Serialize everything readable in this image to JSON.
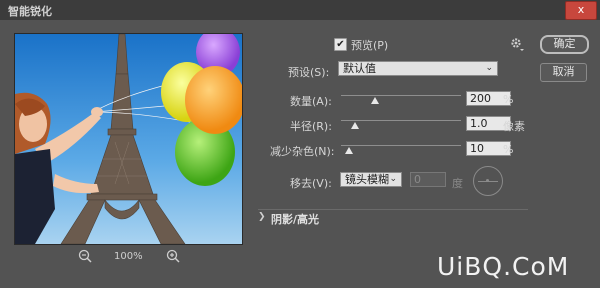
{
  "window": {
    "title": "智能锐化",
    "close_label": "x"
  },
  "preview_panel": {
    "zoom_level": "100%"
  },
  "controls": {
    "preview_label": "预览(P)",
    "preview_checked": true,
    "preset_label": "预设(S):",
    "preset_value": "默认值",
    "amount_label": "数量(A):",
    "amount_value": "200",
    "amount_unit": "%",
    "amount_slider": 0.28,
    "radius_label": "半径(R):",
    "radius_value": "1.0",
    "radius_unit": "像素",
    "radius_slider": 0.12,
    "noise_label": "减少杂色(N):",
    "noise_value": "10",
    "noise_unit": "%",
    "noise_slider": 0.07,
    "remove_label": "移去(V):",
    "remove_value": "镜头模糊",
    "angle_value": "0",
    "angle_unit": "度",
    "section_label": "阴影/高光"
  },
  "buttons": {
    "ok": "确定",
    "cancel": "取消"
  },
  "watermark": "UiBQ.CoM",
  "icons": {
    "zoom_out": "zoom-out-icon",
    "zoom_in": "zoom-in-icon",
    "gear": "gear-icon",
    "check": "checkmark-icon"
  }
}
